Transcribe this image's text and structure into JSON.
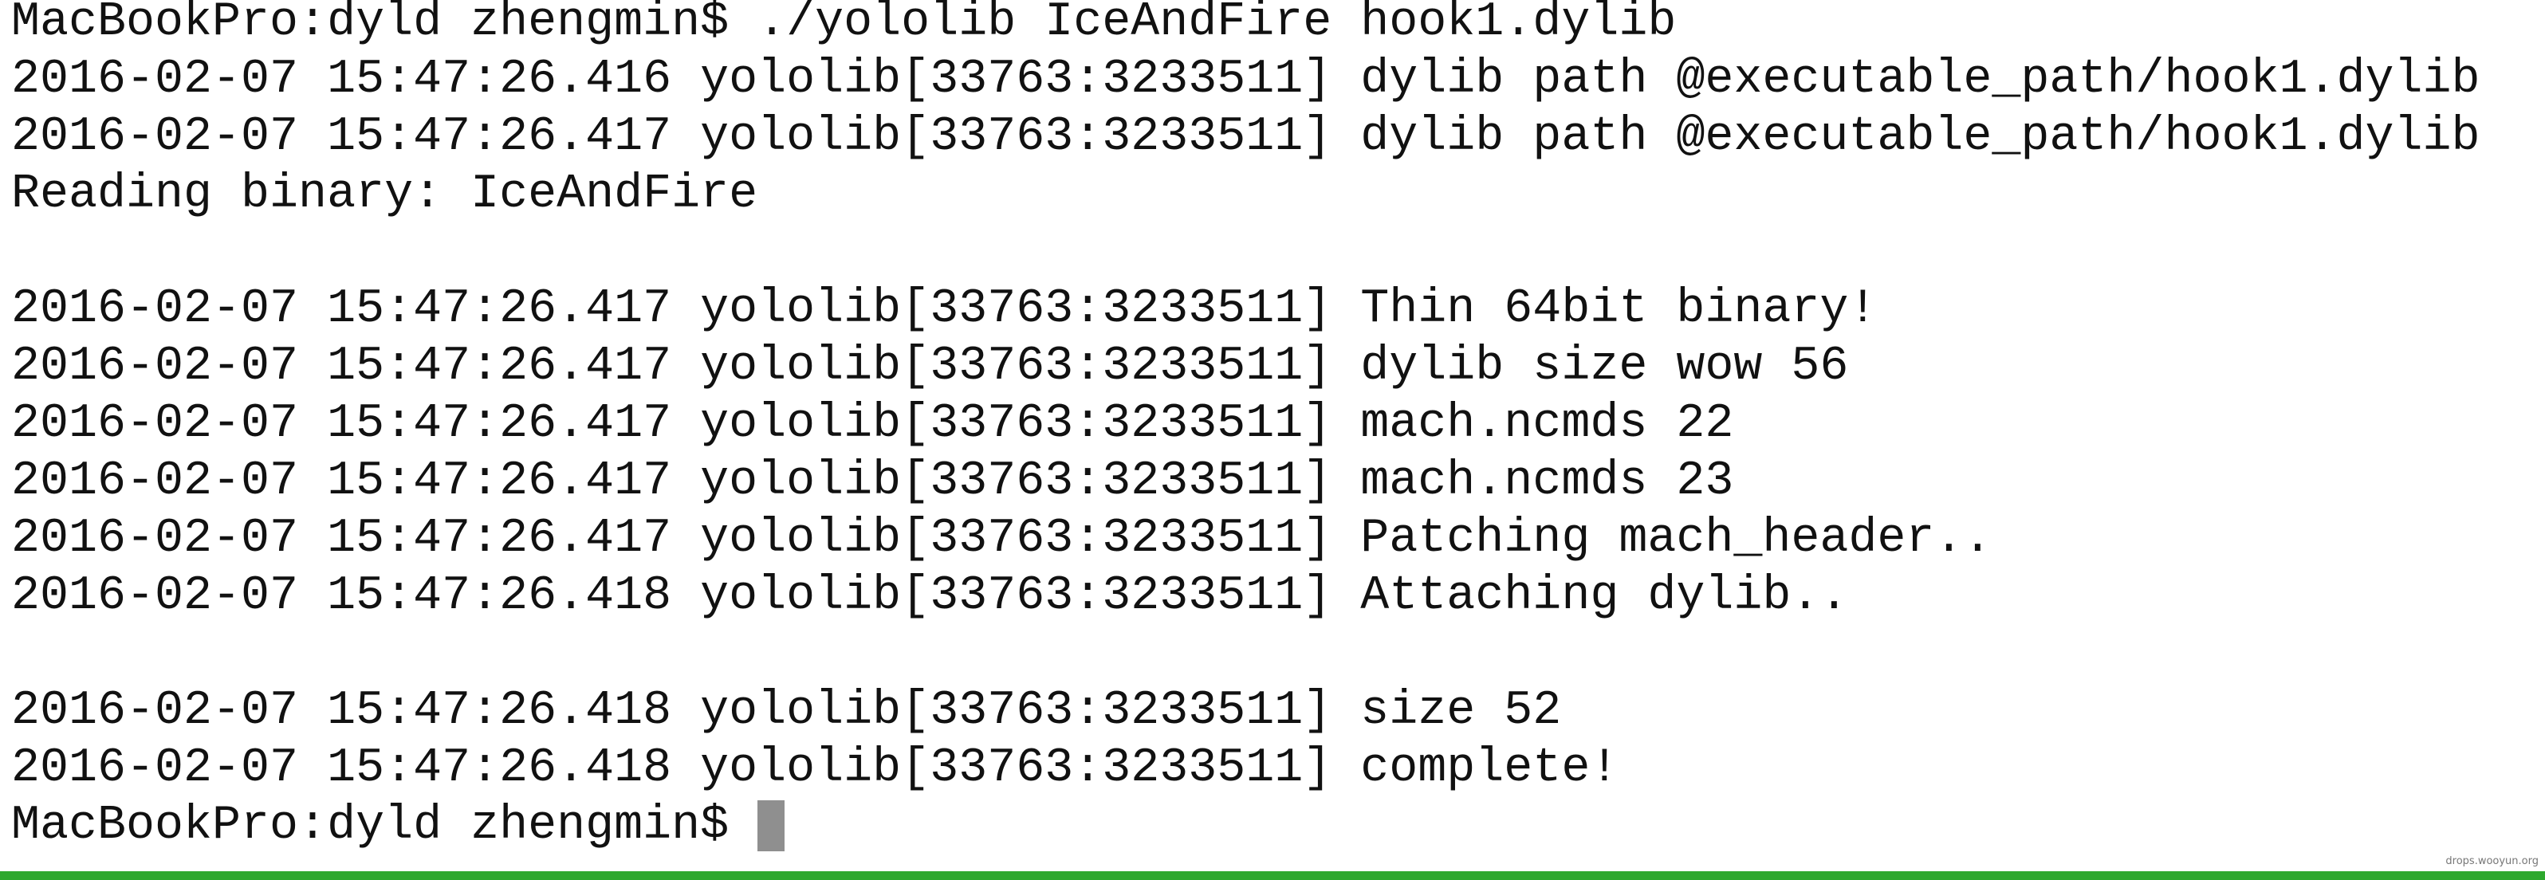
{
  "terminal": {
    "lines": [
      "MacBookPro:dyld zhengmin$ ./yololib IceAndFire hook1.dylib",
      "2016-02-07 15:47:26.416 yololib[33763:3233511] dylib path @executable_path/hook1.dylib",
      "2016-02-07 15:47:26.417 yololib[33763:3233511] dylib path @executable_path/hook1.dylib",
      "Reading binary: IceAndFire",
      "",
      "2016-02-07 15:47:26.417 yololib[33763:3233511] Thin 64bit binary!",
      "2016-02-07 15:47:26.417 yololib[33763:3233511] dylib size wow 56",
      "2016-02-07 15:47:26.417 yololib[33763:3233511] mach.ncmds 22",
      "2016-02-07 15:47:26.417 yololib[33763:3233511] mach.ncmds 23",
      "2016-02-07 15:47:26.417 yololib[33763:3233511] Patching mach_header..",
      "2016-02-07 15:47:26.418 yololib[33763:3233511] Attaching dylib..",
      "",
      "2016-02-07 15:47:26.418 yololib[33763:3233511] size 52",
      "2016-02-07 15:47:26.418 yololib[33763:3233511] complete!"
    ],
    "prompt": "MacBookPro:dyld zhengmin$",
    "status_bar_color": "#2ea82e"
  },
  "watermark": "drops.wooyun.org"
}
